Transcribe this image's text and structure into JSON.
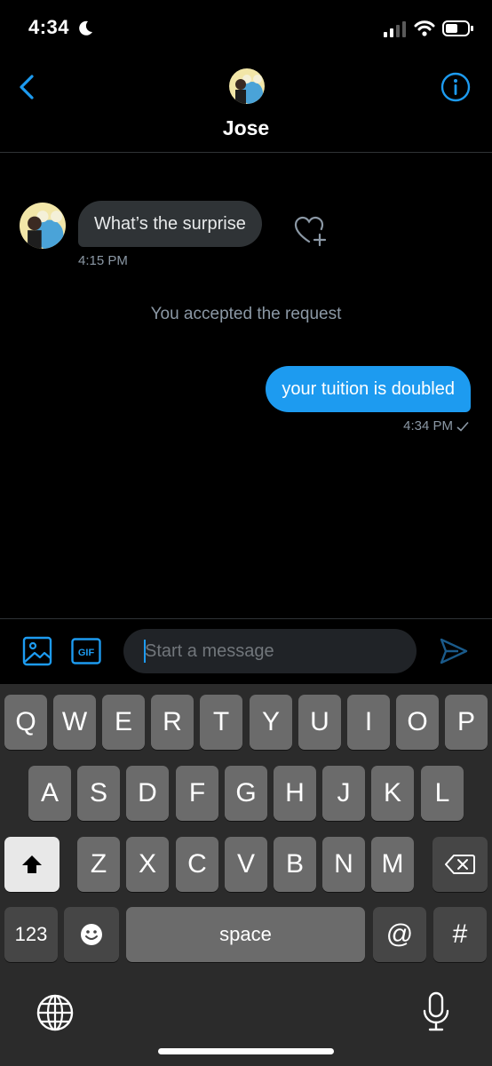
{
  "status_bar": {
    "time": "4:34"
  },
  "header": {
    "contact_name": "Jose"
  },
  "conversation": {
    "incoming": {
      "text": "What’s the surprise",
      "time": "4:15 PM"
    },
    "system_message": "You accepted the request",
    "outgoing": {
      "text": "your tuition is doubled",
      "time": "4:34 PM"
    }
  },
  "composer": {
    "placeholder": "Start a message",
    "gif_label": "GIF"
  },
  "keyboard": {
    "row1": [
      "Q",
      "W",
      "E",
      "R",
      "T",
      "Y",
      "U",
      "I",
      "O",
      "P"
    ],
    "row2": [
      "A",
      "S",
      "D",
      "F",
      "G",
      "H",
      "J",
      "K",
      "L"
    ],
    "row3": [
      "Z",
      "X",
      "C",
      "V",
      "B",
      "N",
      "M"
    ],
    "numbers_label": "123",
    "space_label": "space",
    "at_label": "@",
    "hash_label": "#"
  },
  "colors": {
    "accent": "#1d9bf0",
    "incoming_bubble": "#2f3336",
    "background": "#000000"
  }
}
